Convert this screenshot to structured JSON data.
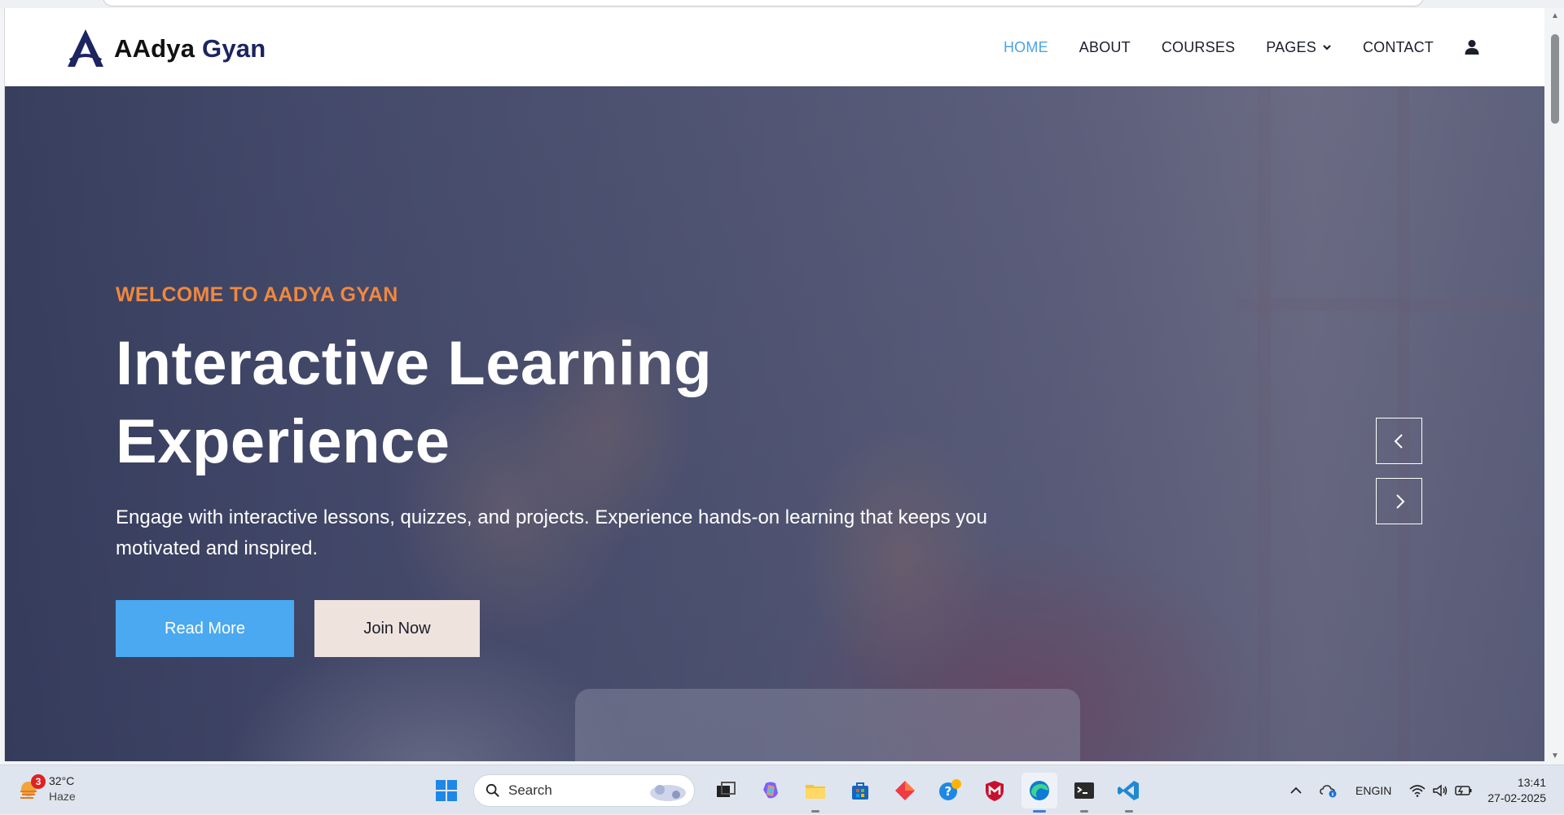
{
  "colors": {
    "accent": "#4aa9f0",
    "eyebrow": "#f0883e",
    "brand_dark": "#1c2462",
    "nav_active": "#4aa3e8"
  },
  "brand": {
    "part1": "AAdya",
    "part2": "Gyan",
    "logo_icon": "peak-a-logo"
  },
  "nav": {
    "items": [
      {
        "label": "HOME",
        "active": true
      },
      {
        "label": "ABOUT"
      },
      {
        "label": "COURSES"
      },
      {
        "label": "PAGES",
        "has_dropdown": true
      },
      {
        "label": "CONTACT"
      }
    ],
    "user_icon": "user-icon"
  },
  "hero": {
    "eyebrow": "WELCOME TO AADYA GYAN",
    "headline_line1": "Interactive Learning",
    "headline_line2": "Experience",
    "description": "Engage with interactive lessons, quizzes, and projects. Experience hands-on learning that keeps you motivated and inspired.",
    "primary_button": "Read More",
    "secondary_button": "Join Now",
    "prev_icon": "chevron-left-icon",
    "next_icon": "chevron-right-icon"
  },
  "taskbar": {
    "weather": {
      "temp": "32°C",
      "condition": "Haze",
      "badge": "3"
    },
    "search_placeholder": "Search",
    "apps": [
      "start",
      "search",
      "task-view",
      "copilot",
      "file-explorer",
      "store",
      "app-red",
      "app-blue-orange",
      "mcafee",
      "edge",
      "terminal",
      "vscode"
    ],
    "lang_top": "ENG",
    "lang_bottom": "IN",
    "time": "13:41",
    "date": "27-02-2025"
  }
}
